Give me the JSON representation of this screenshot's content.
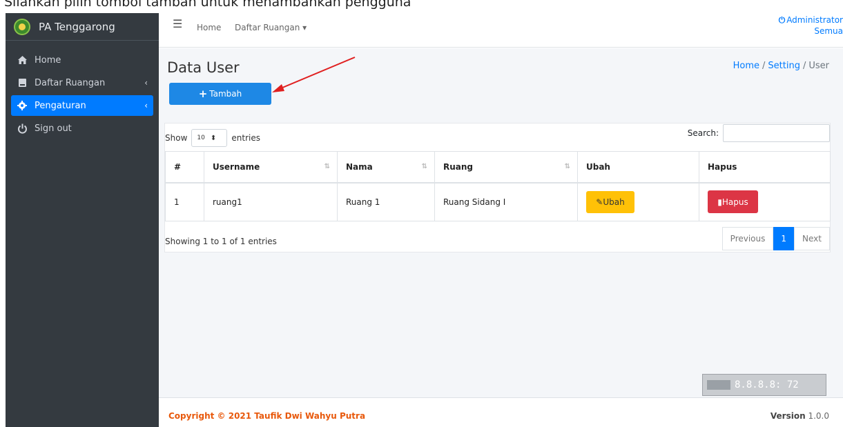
{
  "caption": "Silahkan pilih tombol tambah untuk menambahkan pengguna",
  "brand": {
    "name": "PA Tenggarong"
  },
  "sidebar": {
    "items": [
      {
        "label": "Home",
        "icon": "home-icon"
      },
      {
        "label": "Daftar Ruangan",
        "icon": "book-icon",
        "chevron": "‹"
      },
      {
        "label": "Pengaturan",
        "icon": "gear-icon",
        "chevron": "‹",
        "active": true
      },
      {
        "label": "Sign out",
        "icon": "power-icon"
      }
    ]
  },
  "topbar": {
    "home": "Home",
    "rooms": "Daftar Ruangan",
    "user": "Administrator",
    "role": "Semua"
  },
  "page": {
    "title": "Data User",
    "breadcrumb": [
      "Home",
      "Setting",
      "User"
    ],
    "add_button": "Tambah"
  },
  "table": {
    "show_label": "Show",
    "entries_value": "10",
    "entries_label": "entries",
    "search_label": "Search:",
    "columns": [
      "#",
      "Username",
      "Nama",
      "Ruang",
      "Ubah",
      "Hapus"
    ],
    "rows": [
      {
        "no": "1",
        "username": "ruang1",
        "nama": "Ruang 1",
        "ruang": "Ruang Sidang I",
        "edit": "Ubah",
        "delete": "Hapus"
      }
    ],
    "info": "Showing 1 to 1 of 1 entries",
    "pager": {
      "prev": "Previous",
      "current": "1",
      "next": "Next"
    }
  },
  "overlay": {
    "ip": "8.8.8.8: 72"
  },
  "footer": {
    "copyright": "Copyright © 2021 Taufik Dwi Wahyu Putra",
    "version_label": "Version",
    "version": "1.0.0"
  },
  "colors": {
    "sidebar": "#343a40",
    "primary": "#007bff",
    "warning": "#ffc107",
    "danger": "#dc3545",
    "footer_brand": "#e8590c"
  }
}
